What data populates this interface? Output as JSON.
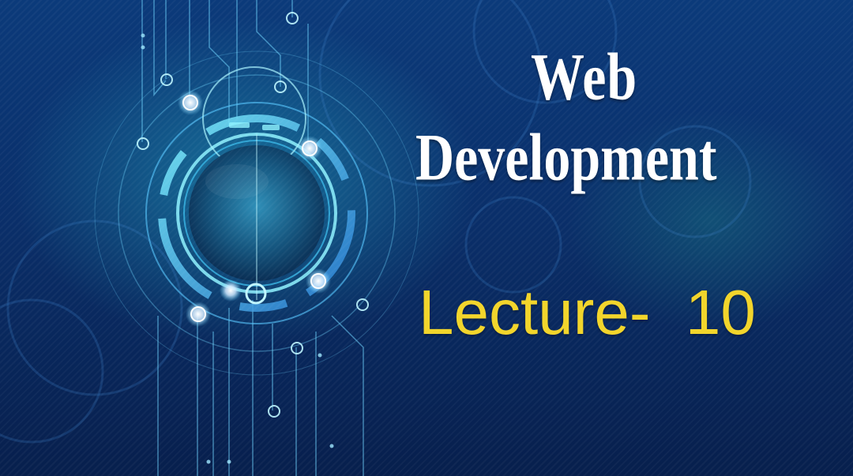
{
  "slide": {
    "title_line_1": "Web",
    "title_line_2": "Development",
    "subtitle": "Lecture-  10"
  },
  "colors": {
    "background_dark": "#071f4d",
    "background_mid": "#0b3a7a",
    "glow_cyan": "#28bed2",
    "title_text": "#ffffff",
    "subtitle_text": "#f2d52c"
  },
  "decoration": {
    "motif": "circuit-lens-graphic"
  }
}
